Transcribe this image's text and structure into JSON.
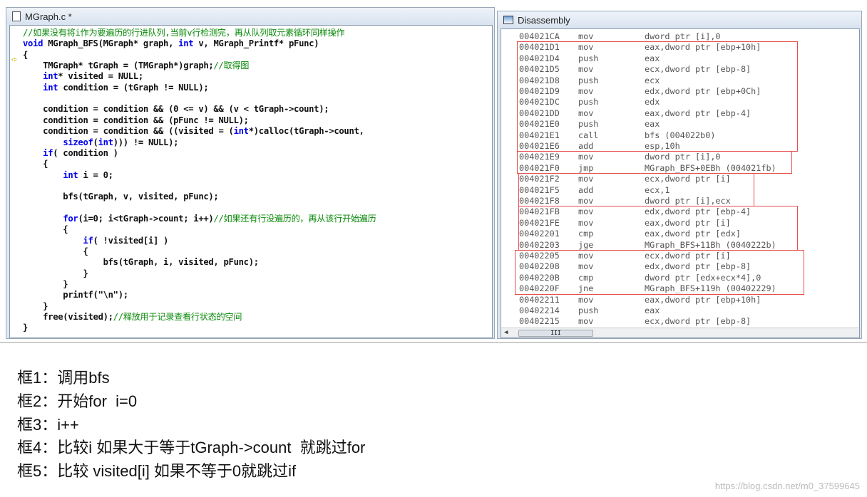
{
  "editor": {
    "title": "MGraph.c *",
    "lines": [
      [
        [
          "//如果没有将i作为要遍历的行进队列,当前v行检测完，再从队列取元素循环同样操作",
          "cm"
        ]
      ],
      [
        [
          "void",
          "kw"
        ],
        [
          " MGraph_BFS(MGraph* graph, ",
          ""
        ],
        [
          "int",
          "kw"
        ],
        [
          " v, MGraph_Printf* pFunc)",
          ""
        ]
      ],
      [
        [
          "{",
          ""
        ]
      ],
      [
        [
          "    TMGraph* tGraph = (TMGraph*)graph;",
          ""
        ],
        [
          "//取得图",
          "cm"
        ]
      ],
      [
        [
          "    ",
          ""
        ],
        [
          "int",
          "kw"
        ],
        [
          "* visited = NULL;",
          ""
        ]
      ],
      [
        [
          "    ",
          ""
        ],
        [
          "int",
          "kw"
        ],
        [
          " condition = (tGraph != NULL);",
          ""
        ]
      ],
      [],
      [
        [
          "    condition = condition && (0 <= v) && (v < tGraph->count);",
          ""
        ]
      ],
      [
        [
          "    condition = condition && (pFunc != NULL);",
          ""
        ]
      ],
      [
        [
          "    condition = condition && ((visited = (",
          ""
        ],
        [
          "int",
          "kw"
        ],
        [
          "*)calloc(tGraph->count,",
          ""
        ]
      ],
      [
        [
          "        ",
          ""
        ],
        [
          "sizeof",
          "kw"
        ],
        [
          "(",
          ""
        ],
        [
          "int",
          "kw"
        ],
        [
          "))) != NULL);",
          ""
        ]
      ],
      [
        [
          "    ",
          ""
        ],
        [
          "if",
          "kw"
        ],
        [
          "( condition )",
          ""
        ]
      ],
      [
        [
          "    {",
          ""
        ]
      ],
      [
        [
          "        ",
          ""
        ],
        [
          "int",
          "kw"
        ],
        [
          " i = 0;",
          ""
        ]
      ],
      [],
      [
        [
          "        bfs(tGraph, v, visited, pFunc);",
          ""
        ]
      ],
      [],
      [
        [
          "        ",
          ""
        ],
        [
          "for",
          "kw"
        ],
        [
          "(i=0; i<tGraph->count; i++)",
          ""
        ],
        [
          "//如果还有行没遍历的，再从该行开始遍历",
          "cm"
        ]
      ],
      [
        [
          "        {",
          ""
        ]
      ],
      [
        [
          "            ",
          ""
        ],
        [
          "if",
          "kw"
        ],
        [
          "( !visited[i] )",
          ""
        ]
      ],
      [
        [
          "            {",
          ""
        ]
      ],
      [
        [
          "                bfs(tGraph, i, visited, pFunc);",
          ""
        ]
      ],
      [
        [
          "            }",
          ""
        ]
      ],
      [
        [
          "        }",
          ""
        ]
      ],
      [
        [
          "        printf(\"\\n\");",
          ""
        ]
      ],
      [
        [
          "    }",
          ""
        ]
      ],
      [
        [
          "    free(visited);",
          ""
        ],
        [
          "//释放用于记录查看行状态的空间",
          "cm"
        ]
      ],
      [
        [
          "}",
          ""
        ]
      ]
    ]
  },
  "disassembly": {
    "title": "Disassembly",
    "rows": [
      [
        "004021CA",
        "mov",
        "dword ptr [i],0"
      ],
      [
        "004021D1",
        "mov",
        "eax,dword ptr [ebp+10h]"
      ],
      [
        "004021D4",
        "push",
        "eax"
      ],
      [
        "004021D5",
        "mov",
        "ecx,dword ptr [ebp-8]"
      ],
      [
        "004021D8",
        "push",
        "ecx"
      ],
      [
        "004021D9",
        "mov",
        "edx,dword ptr [ebp+0Ch]"
      ],
      [
        "004021DC",
        "push",
        "edx"
      ],
      [
        "004021DD",
        "mov",
        "eax,dword ptr [ebp-4]"
      ],
      [
        "004021E0",
        "push",
        "eax"
      ],
      [
        "004021E1",
        "call",
        "bfs (004022b0)"
      ],
      [
        "004021E6",
        "add",
        "esp,10h"
      ],
      [
        "004021E9",
        "mov",
        "dword ptr [i],0"
      ],
      [
        "004021F0",
        "jmp",
        "MGraph_BFS+0EBh (004021fb)"
      ],
      [
        "004021F2",
        "mov",
        "ecx,dword ptr [i]"
      ],
      [
        "004021F5",
        "add",
        "ecx,1"
      ],
      [
        "004021F8",
        "mov",
        "dword ptr [i],ecx"
      ],
      [
        "004021FB",
        "mov",
        "edx,dword ptr [ebp-4]"
      ],
      [
        "004021FE",
        "mov",
        "eax,dword ptr [i]"
      ],
      [
        "00402201",
        "cmp",
        "eax,dword ptr [edx]"
      ],
      [
        "00402203",
        "jge",
        "MGraph_BFS+11Bh (0040222b)"
      ],
      [
        "00402205",
        "mov",
        "ecx,dword ptr [i]"
      ],
      [
        "00402208",
        "mov",
        "edx,dword ptr [ebp-8]"
      ],
      [
        "0040220B",
        "cmp",
        "dword ptr [edx+ecx*4],0"
      ],
      [
        "0040220F",
        "jne",
        "MGraph_BFS+119h (00402229)"
      ],
      [
        "00402211",
        "mov",
        "eax,dword ptr [ebp+10h]"
      ],
      [
        "00402214",
        "push",
        "eax"
      ],
      [
        "00402215",
        "mov",
        "ecx,dword ptr [ebp-8]"
      ]
    ],
    "highlight_color": "#e84c4c"
  },
  "notes": [
    "框1：调用bfs",
    "框2：开始for  i=0",
    "框3：i++",
    "框4：比较i 如果大于等于tGraph->count  就跳过for",
    "框5：比较 visited[i] 如果不等于0就跳过if"
  ],
  "watermark": "https://blog.csdn.net/m0_37599645"
}
